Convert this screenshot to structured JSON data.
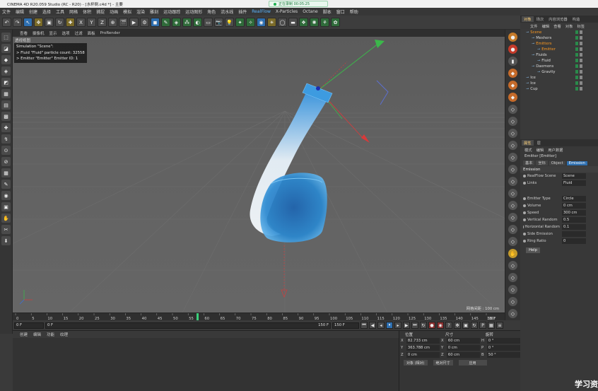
{
  "window": {
    "title": "CINEMA 4D R20.059 Studio (RC - R20) - [水杯倒.c4d *] - 主要",
    "recording_badge": "正在录制 00:05:25"
  },
  "menubar": [
    "文件",
    "编辑",
    "创建",
    "选择",
    "工具",
    "网格",
    "体积",
    "捕捉",
    "动画",
    "模拟",
    "渲染",
    "雕刻",
    "运动跟踪",
    "运动图形",
    "角色",
    "流水线",
    "插件",
    "RealFlow",
    "X-Particles",
    "Octane",
    "脚本",
    "窗口",
    "帮助"
  ],
  "toolbar": {
    "undo": "↶",
    "axes": [
      "X",
      "Y",
      "Z"
    ]
  },
  "viewport": {
    "menu": [
      "查看",
      "摄像机",
      "显示",
      "选项",
      "过滤",
      "面板",
      "ProRender"
    ],
    "label": "透视视图",
    "sim_info": [
      "Simulation \"Scene\":",
      "  > Fluid \"Fluid\" particle count: 32558",
      "  > Emitter \"Emitter\" Emitter ID: 1"
    ],
    "grid_label": "网格间距 : 100 cm"
  },
  "timeline": {
    "ticks": [
      "0",
      "5",
      "10",
      "15",
      "20",
      "25",
      "30",
      "35",
      "40",
      "45",
      "50",
      "55",
      "60",
      "65",
      "70",
      "75",
      "80",
      "85",
      "90",
      "95",
      "100",
      "105",
      "110",
      "115",
      "120",
      "125",
      "130",
      "135",
      "140",
      "145",
      "150"
    ],
    "current_frame": "58 F",
    "current_frame_value": 58,
    "total_frames": 150
  },
  "playbar": {
    "start": "0 F",
    "start2": "0 F",
    "end": "150 F",
    "end2": "150 F"
  },
  "material_manager": {
    "menu": [
      "创建",
      "编辑",
      "功能",
      "纹理"
    ]
  },
  "coordinates": {
    "headers": [
      "位置",
      "尺寸",
      "旋转"
    ],
    "rows": [
      {
        "pos_label": "X",
        "pos": "82.733 cm",
        "size_label": "X",
        "size": "60 cm",
        "rot_label": "H",
        "rot": "0 °"
      },
      {
        "pos_label": "Y",
        "pos": "363.788 cm",
        "size_label": "Y",
        "size": "0 cm",
        "rot_label": "P",
        "rot": "0 °"
      },
      {
        "pos_label": "Z",
        "pos": "0 cm",
        "size_label": "Z",
        "size": "60 cm",
        "rot_label": "B",
        "rot": "50 °"
      }
    ],
    "mode_object": "对象 (相对)",
    "mode_size": "绝对尺寸",
    "apply": "应用"
  },
  "object_manager": {
    "tabs": [
      "对象",
      "场次",
      "内容浏览器",
      "构造"
    ],
    "menu": [
      "文件",
      "编辑",
      "查看",
      "对象",
      "标签"
    ],
    "items": [
      {
        "name": "Scene",
        "indent": 0,
        "style": "sel"
      },
      {
        "name": "Meshers",
        "indent": 1,
        "style": ""
      },
      {
        "name": "Emitters",
        "indent": 1,
        "style": "sel"
      },
      {
        "name": "Emitter",
        "indent": 2,
        "style": "sel"
      },
      {
        "name": "Fluids",
        "indent": 1,
        "style": ""
      },
      {
        "name": "Fluid",
        "indent": 2,
        "style": ""
      },
      {
        "name": "Daemons",
        "indent": 1,
        "style": ""
      },
      {
        "name": "Gravity",
        "indent": 2,
        "style": ""
      },
      {
        "name": "Ice",
        "indent": 0,
        "style": ""
      },
      {
        "name": "Ice",
        "indent": 0,
        "style": ""
      },
      {
        "name": "Cup",
        "indent": 0,
        "style": ""
      }
    ]
  },
  "attributes": {
    "tabs": [
      "属性",
      "层"
    ],
    "menu": [
      "模式",
      "编辑",
      "用户数据"
    ],
    "title": "Emitter [Emitter]",
    "subtabs": [
      "基本",
      "坐标",
      "Object",
      "Emission"
    ],
    "section": "Emission",
    "rows1": [
      {
        "label": "RealFlow Scene",
        "value": "Scene"
      },
      {
        "label": "Links",
        "value": "Fluid"
      }
    ],
    "rows2": [
      {
        "label": "Emitter Type",
        "value": "Circle"
      },
      {
        "label": "Volume",
        "value": "0 cm"
      },
      {
        "label": "Speed",
        "value": "300 cm"
      },
      {
        "label": "Vertical Random",
        "value": "0.5"
      },
      {
        "label": "Horizontal Random",
        "value": "0.1"
      },
      {
        "label": "Side Emission",
        "value": ""
      },
      {
        "label": "Ring Ratio",
        "value": "0"
      }
    ],
    "help": "Help"
  },
  "watermark": "学习资"
}
